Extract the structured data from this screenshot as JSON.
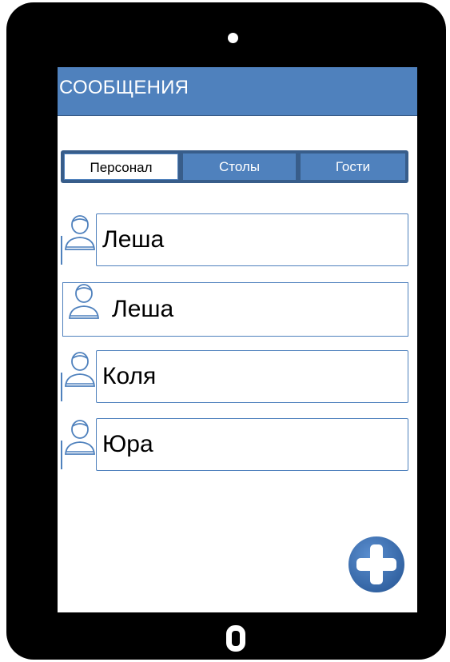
{
  "header": {
    "title": "СООБЩЕНИЯ"
  },
  "tabs": [
    {
      "label": "Персонал",
      "active": true
    },
    {
      "label": "Столы",
      "active": false
    },
    {
      "label": "Гости",
      "active": false
    }
  ],
  "contacts": [
    {
      "name": "Леша",
      "icon": "user-icon"
    },
    {
      "name": "Леша",
      "icon": "user-icon"
    },
    {
      "name": "Коля",
      "icon": "user-icon"
    },
    {
      "name": "Юра",
      "icon": "user-icon"
    }
  ],
  "fab": {
    "icon": "plus-icon"
  },
  "colors": {
    "accent": "#4f81bd",
    "accent_dark": "#385d8a",
    "device": "#000000",
    "screen": "#ffffff"
  }
}
